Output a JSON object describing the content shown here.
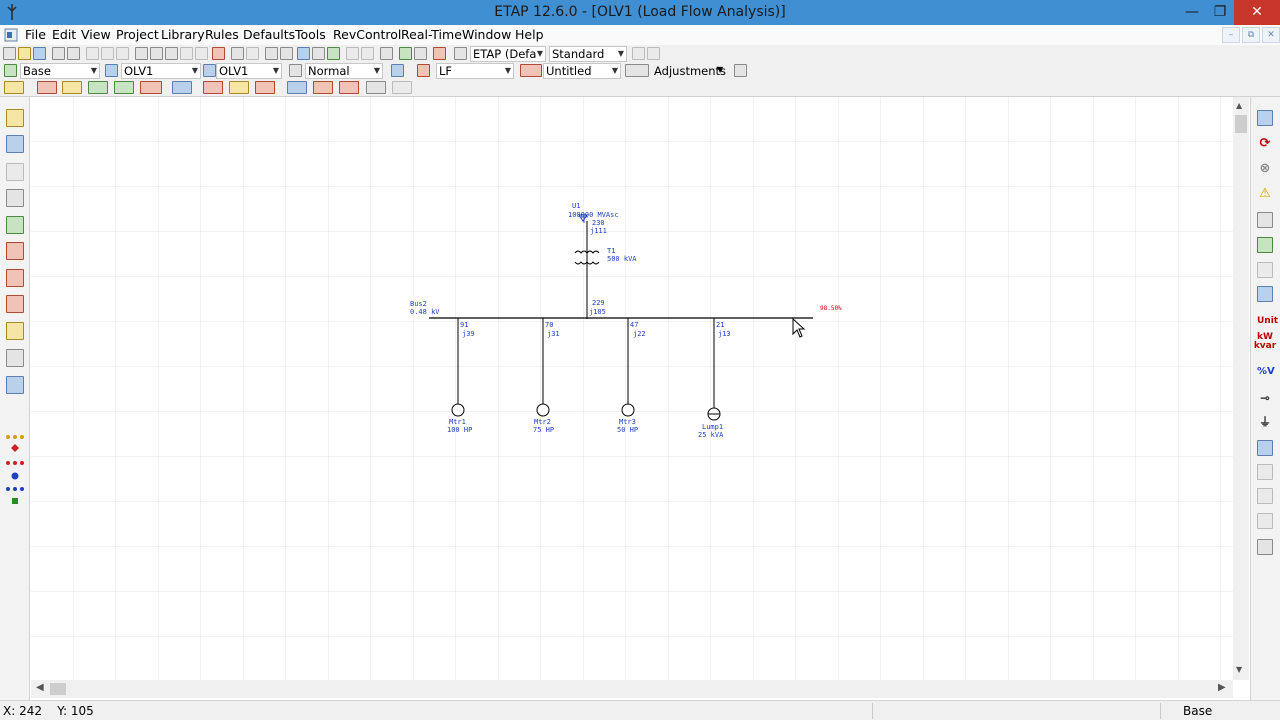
{
  "window": {
    "title": "ETAP 12.6.0 - [OLV1 (Load Flow Analysis)]",
    "minimize": "—",
    "restore": "❐",
    "close": "✕"
  },
  "menu": {
    "items": [
      "File",
      "Edit",
      "View",
      "Project",
      "Library",
      "Rules",
      "Defaults",
      "Tools",
      "RevControl",
      "Real-Time",
      "Window",
      "Help"
    ]
  },
  "mdi": {
    "minimize": "–",
    "restore": "⧉",
    "close": "✕"
  },
  "toolbar": {
    "study_case": "ETAP (Defa",
    "standard": "Standard",
    "presentation": "Base",
    "config": "OLV1",
    "view": "OLV1",
    "mode": "Normal",
    "analysis": "LF",
    "revision": "Untitled",
    "adjustments": "Adjustments"
  },
  "diagram": {
    "utility": {
      "name": "U1",
      "rating": "100000 MVAsc",
      "p": "230",
      "q": "j111"
    },
    "transformer": {
      "name": "T1",
      "rating": "500 kVA"
    },
    "bus": {
      "name": "Bus2",
      "voltage": "0.48 kV",
      "p": "229",
      "q": "j105",
      "percent": "98.50%"
    },
    "loads": [
      {
        "name": "Mtr1",
        "rating": "100 HP",
        "p": "91",
        "q": "j39"
      },
      {
        "name": "Mtr2",
        "rating": "75 HP",
        "p": "70",
        "q": "j31"
      },
      {
        "name": "Mtr3",
        "rating": "50 HP",
        "p": "47",
        "q": "j22"
      },
      {
        "name": "Lump1",
        "rating": "25 kVA",
        "p": "21",
        "q": "j13"
      }
    ]
  },
  "right_toolbar": {
    "unit_label": "Unit",
    "kw_label": "kW",
    "kvar_label": "kvar",
    "pct_v_label": "%V"
  },
  "status": {
    "coords": "X: 242    Y: 105",
    "presentation": "Base"
  },
  "colors": {
    "titlebar": "#3f8fd2",
    "diagram_text": "#1f3fbf",
    "result_red": "#c00000"
  }
}
